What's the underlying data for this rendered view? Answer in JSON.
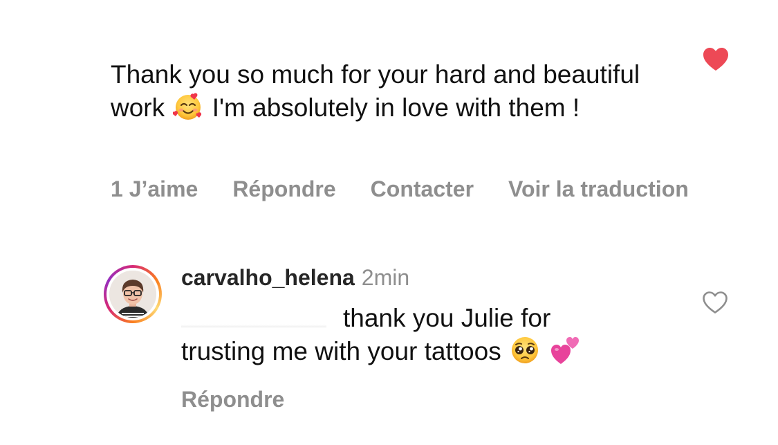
{
  "comment": {
    "text_part1": "Thank you so much for your hard and beautiful work",
    "emoji": "smiling-face-with-hearts",
    "text_part2": "I'm absolutely in love with them !",
    "liked": true,
    "actions": {
      "likes": "1 J’aime",
      "reply": "Répondre",
      "contact": "Contacter",
      "translate": "Voir la traduction"
    }
  },
  "reply": {
    "username": "carvalho_helena",
    "time": "2min",
    "text_line1": "thank you Julie for",
    "text_line2": "trusting me with your tattoos",
    "emojis": [
      "pleading-face",
      "two-hearts"
    ],
    "liked": false,
    "actions": {
      "reply": "Répondre"
    }
  },
  "colors": {
    "like_red": "#ed4956",
    "secondary_text": "#8e8e8e",
    "primary_text": "#111111"
  }
}
